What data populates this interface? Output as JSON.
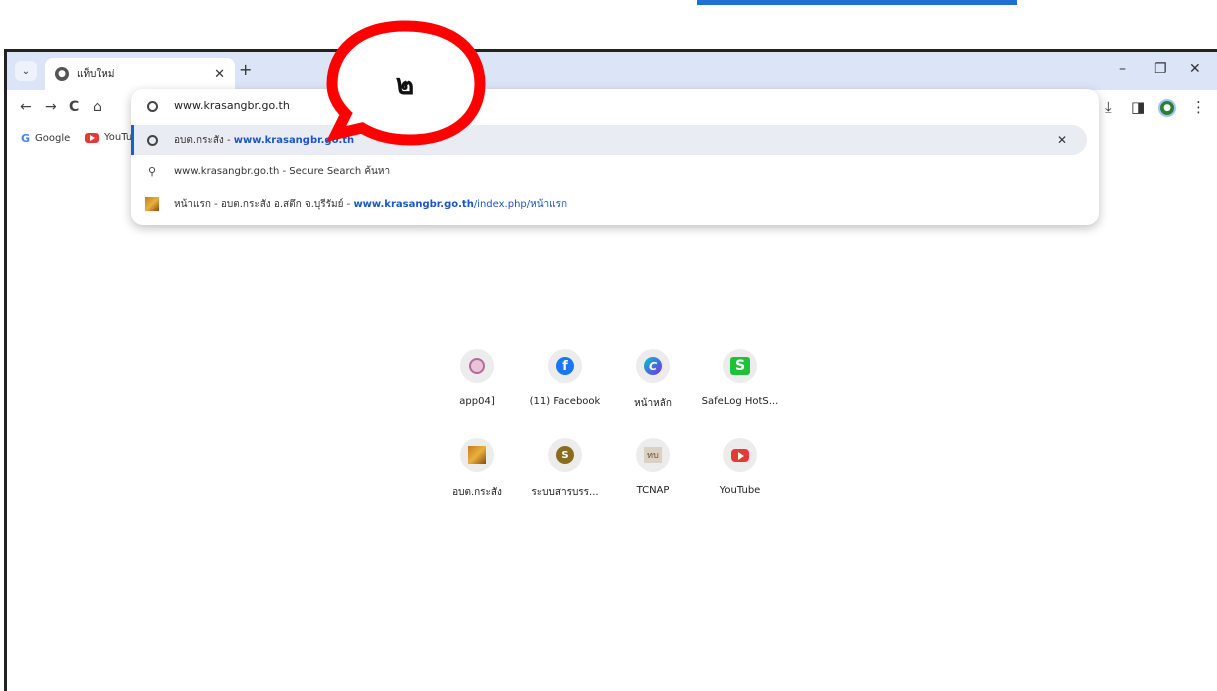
{
  "browser": {
    "tab": {
      "title": "แท็บใหม่"
    },
    "window_controls": {
      "minimize": "–",
      "restore": "❐",
      "close": "✕"
    }
  },
  "toolbar": {
    "back": "←",
    "forward": "→",
    "reload": "C",
    "home": "⌂",
    "download": "⤓",
    "sidebar": "◨",
    "menu": "⋮"
  },
  "bookmarks": [
    {
      "label": "Google"
    },
    {
      "label": "YouTub"
    }
  ],
  "omnibox": {
    "value": "www.krasangbr.go.th",
    "suggestions": [
      {
        "prefix": "อบต.กระสัง - ",
        "url": "www.krasangbr.go.th",
        "selected": true
      },
      {
        "text": "www.krasangbr.go.th - Secure Search ค้นหา"
      },
      {
        "prefix": "หน้าแรก - อบต.กระสัง อ.สตึก จ.บุรีรัมย์ - ",
        "url": "www.krasangbr.go.th",
        "path": "/index.php/หน้าแรก"
      }
    ]
  },
  "shortcuts": [
    {
      "label": "app04]",
      "icon": "seal-icon"
    },
    {
      "label": "(11) Facebook",
      "icon": "facebook-icon",
      "glyph": "f"
    },
    {
      "label": "หน้าหลัก",
      "icon": "canva-icon",
      "glyph": "C"
    },
    {
      "label": "SafeLog HotS...",
      "icon": "safelog-icon",
      "glyph": "S"
    },
    {
      "label": "อบต.กระสัง",
      "icon": "photo-icon"
    },
    {
      "label": "ระบบสารบรร...",
      "icon": "coin-icon",
      "glyph": "S"
    },
    {
      "label": "TCNAP",
      "icon": "tcnap-icon",
      "glyph": "ทบ"
    },
    {
      "label": "YouTube",
      "icon": "youtube-icon"
    }
  ],
  "callout": {
    "number": "๒"
  },
  "colors": {
    "accent": "#1f6fd6",
    "callout": "#ff0000",
    "tabstrip": "#dbe5f7"
  }
}
